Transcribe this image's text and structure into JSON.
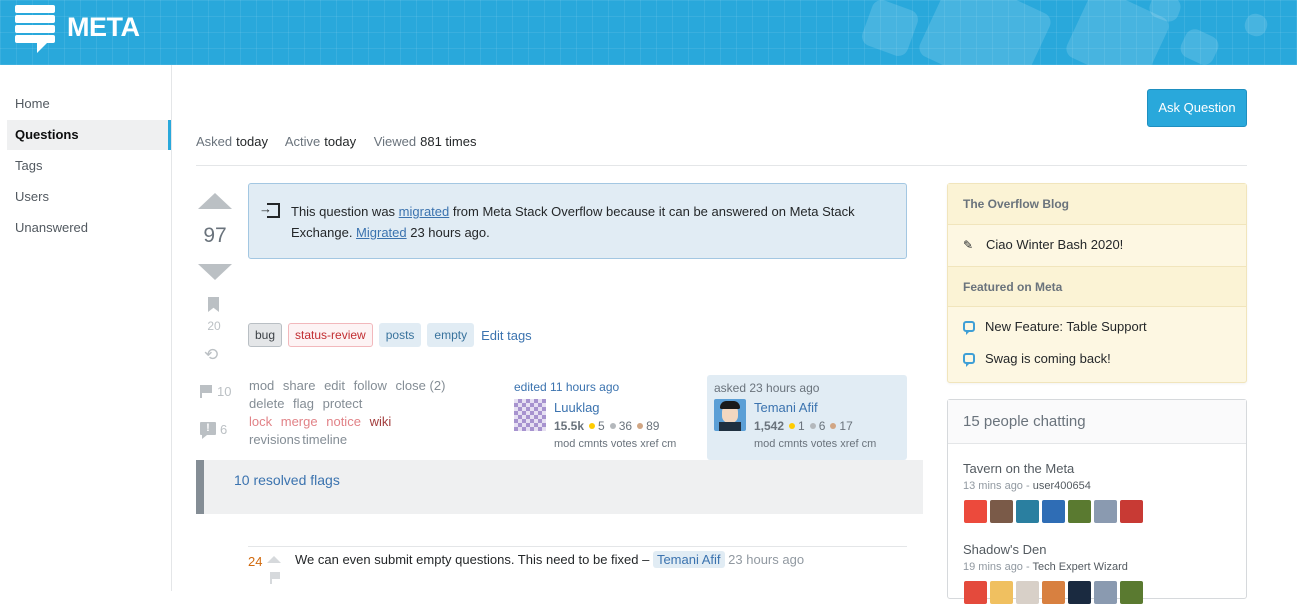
{
  "header": {
    "logo_text": "META",
    "brand_color": "#29a8db"
  },
  "leftnav": {
    "items": [
      {
        "label": "Home",
        "active": false
      },
      {
        "label": "Questions",
        "active": true
      },
      {
        "label": "Tags",
        "active": false
      },
      {
        "label": "Users",
        "active": false
      },
      {
        "label": "Unanswered",
        "active": false
      }
    ]
  },
  "question": {
    "ask_button": "Ask Question",
    "meta": {
      "asked_label": "Asked",
      "asked_value": "today",
      "active_label": "Active",
      "active_value": "today",
      "viewed_label": "Viewed",
      "viewed_value": "881 times"
    },
    "votes": "97",
    "bookmarks": "20",
    "flags": "10",
    "comment_flags": "6",
    "notice": {
      "text_1": "This question was ",
      "link_1": "migrated",
      "text_2": " from Meta Stack Overflow because it can be answered on Meta Stack Exchange. ",
      "link_2": "Migrated",
      "text_3": " 23 hours ago."
    },
    "tags": [
      {
        "label": "bug",
        "style": "bug"
      },
      {
        "label": "status-review",
        "style": "status"
      },
      {
        "label": "posts",
        "style": "plain"
      },
      {
        "label": "empty",
        "style": "plain"
      }
    ],
    "edit_tags": "Edit tags",
    "post_menu": {
      "row1": [
        "mod",
        "share",
        "edit",
        "follow",
        "close (2)"
      ],
      "row2": [
        "delete",
        "flag",
        "protect"
      ],
      "row3_mod": [
        "lock",
        "merge",
        "notice"
      ],
      "row3_wiki": "wiki",
      "row4": [
        "revisions",
        "timeline"
      ]
    },
    "editor": {
      "action": "edited 11 hours ago",
      "name": "Luuklag",
      "rep": "15.5k",
      "gold": "5",
      "silver": "36",
      "bronze": "89",
      "links": "mod cmnts votes xref cm"
    },
    "asker": {
      "action": "asked 23 hours ago",
      "name": "Temani Afif",
      "rep": "1,542",
      "gold": "1",
      "silver": "6",
      "bronze": "17",
      "links": "mod cmnts votes xref cm"
    },
    "badge_colors": {
      "gold": "#ffcc01",
      "silver": "#b4b8bc",
      "bronze": "#d1a684"
    },
    "resolved_flags": "10 resolved flags",
    "comment": {
      "score": "24",
      "text": "We can even submit empty questions. This need to be fixed – ",
      "user": "Temani Afif",
      "time": " 23 hours ago"
    }
  },
  "sidebar": {
    "blog_header": "The Overflow Blog",
    "blog_items": [
      "Ciao Winter Bash 2020!"
    ],
    "featured_header": "Featured on Meta",
    "featured_items": [
      "New Feature: Table Support",
      "Swag is coming back!"
    ],
    "chat": {
      "header": "15 people chatting",
      "rooms": [
        {
          "name": "Tavern on the Meta",
          "time": "13 mins ago",
          "sep": " - ",
          "user": "user400654",
          "avatar_colors": [
            "#ec4a3c",
            "#7a5a48",
            "#2a7fa0",
            "#2f6db5",
            "#5a7a30",
            "#8a9ab0",
            "#c83a34"
          ]
        },
        {
          "name": "Shadow's Den",
          "time": "19 mins ago",
          "sep": " - ",
          "user": "Tech Expert Wizard",
          "avatar_colors": [
            "#e44a3c",
            "#f0c060",
            "#d8d0c8",
            "#d88040",
            "#1a2a40",
            "#8a9ab0",
            "#5a7a30"
          ]
        }
      ]
    }
  }
}
